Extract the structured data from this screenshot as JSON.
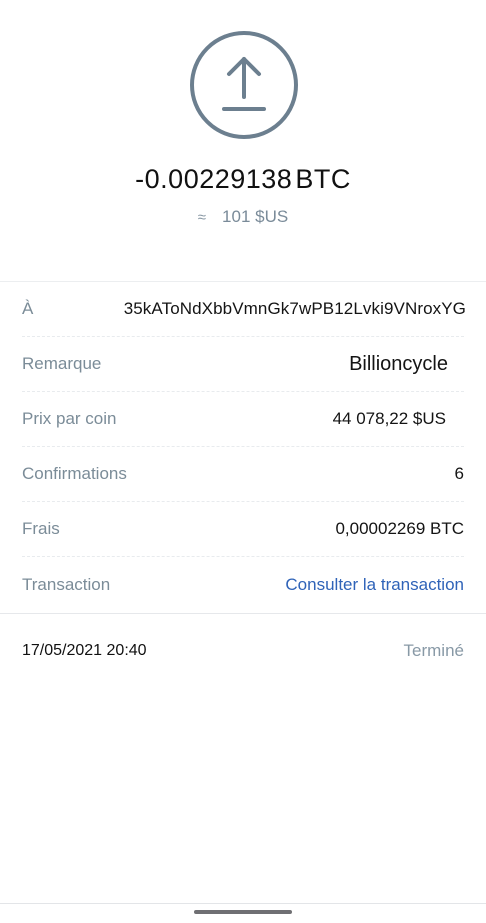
{
  "header": {
    "icon": "upload-arrow-icon",
    "amount": "-0.00229138",
    "amount_unit": "BTC",
    "approx_symbol": "≈",
    "fiat_value": "101 $US"
  },
  "details": [
    {
      "label": "À",
      "value": "35kAToNdXbbVmnGk7wPB12Lvki9VNroxYG"
    },
    {
      "label": "Remarque",
      "value": "Billioncycle"
    },
    {
      "label": "Prix par coin",
      "value": "44 078,22 $US"
    },
    {
      "label": "Confirmations",
      "value": "6"
    },
    {
      "label": "Frais",
      "value": "0,00002269 BTC"
    },
    {
      "label": "Transaction",
      "value": "Consulter la transaction"
    }
  ],
  "footer": {
    "date": "17/05/2021 20:40",
    "status": "Terminé"
  },
  "colors": {
    "accent_link": "#2f63b8",
    "icon_stroke": "#6c7f8f",
    "label_gray": "#7b8c98"
  }
}
